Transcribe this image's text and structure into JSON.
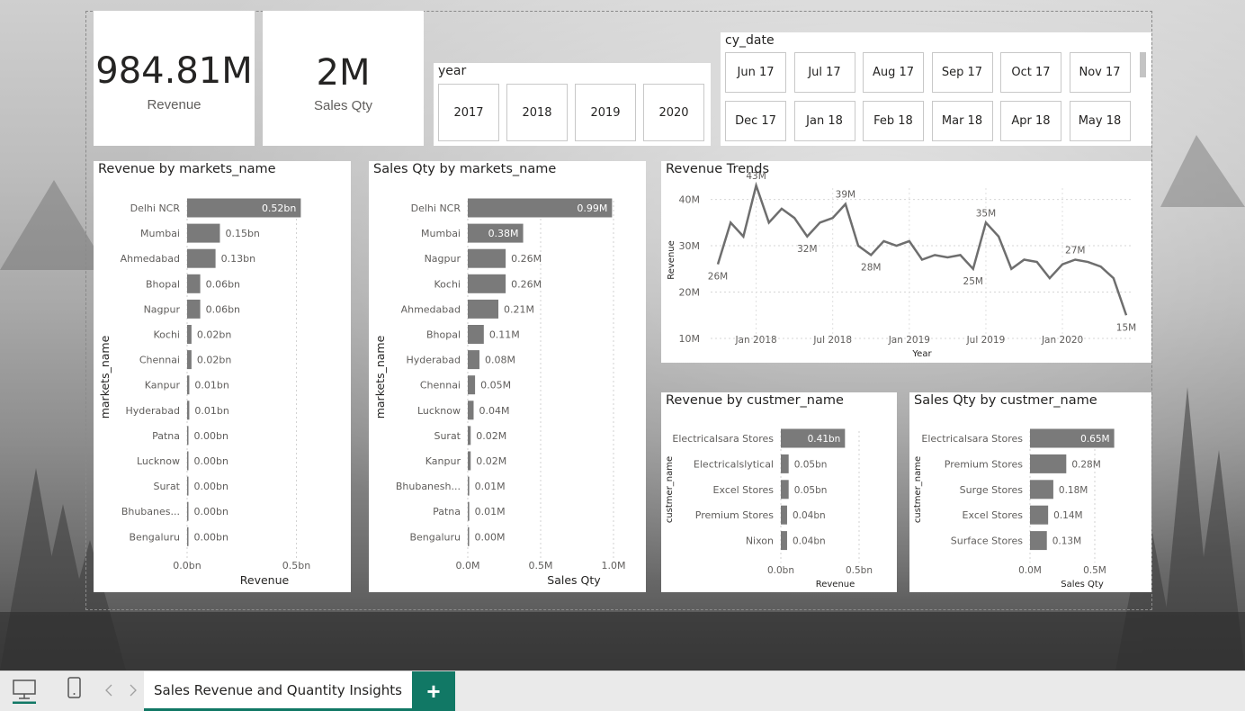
{
  "kpis": {
    "revenue": {
      "value": "984.81M",
      "label": "Revenue"
    },
    "sales_qty": {
      "value": "2M",
      "label": "Sales Qty"
    }
  },
  "year_slicer": {
    "title": "year",
    "options": [
      "2017",
      "2018",
      "2019",
      "2020"
    ]
  },
  "date_slicer": {
    "title": "cy_date",
    "options": [
      "Jun 17",
      "Jul 17",
      "Aug 17",
      "Sep 17",
      "Oct 17",
      "Nov 17",
      "Dec 17",
      "Jan 18",
      "Feb 18",
      "Mar 18",
      "Apr 18",
      "May 18"
    ]
  },
  "tabs": {
    "active": "Sales Revenue and Quantity Insights",
    "add": "+"
  },
  "colors": {
    "bar": "#7a7a7a",
    "accent": "#117865",
    "line": "#6e6e6e"
  },
  "chart_data": [
    {
      "type": "bar",
      "orientation": "horizontal",
      "title": "Revenue by markets_name",
      "xlabel": "Revenue",
      "ylabel": "markets_name",
      "categories": [
        "Delhi NCR",
        "Mumbai",
        "Ahmedabad",
        "Bhopal",
        "Nagpur",
        "Kochi",
        "Chennai",
        "Kanpur",
        "Hyderabad",
        "Patna",
        "Lucknow",
        "Surat",
        "Bhubanes...",
        "Bengaluru"
      ],
      "values": [
        0.52,
        0.15,
        0.13,
        0.06,
        0.06,
        0.02,
        0.02,
        0.01,
        0.01,
        0.0,
        0.0,
        0.0,
        0.0,
        0.0
      ],
      "labels": [
        "0.52bn",
        "0.15bn",
        "0.13bn",
        "0.06bn",
        "0.06bn",
        "0.02bn",
        "0.02bn",
        "0.01bn",
        "0.01bn",
        "0.00bn",
        "0.00bn",
        "0.00bn",
        "0.00bn",
        "0.00bn"
      ],
      "xticks": [
        0,
        0.5
      ],
      "xtick_labels": [
        "0.0bn",
        "0.5bn"
      ],
      "xlim": [
        0,
        0.65
      ]
    },
    {
      "type": "bar",
      "orientation": "horizontal",
      "title": "Sales Qty by markets_name",
      "xlabel": "Sales Qty",
      "ylabel": "markets_name",
      "categories": [
        "Delhi NCR",
        "Mumbai",
        "Nagpur",
        "Kochi",
        "Ahmedabad",
        "Bhopal",
        "Hyderabad",
        "Chennai",
        "Lucknow",
        "Surat",
        "Kanpur",
        "Bhubanesh...",
        "Patna",
        "Bengaluru"
      ],
      "values": [
        0.99,
        0.38,
        0.26,
        0.26,
        0.21,
        0.11,
        0.08,
        0.05,
        0.04,
        0.02,
        0.02,
        0.01,
        0.01,
        0.0
      ],
      "labels": [
        "0.99M",
        "0.38M",
        "0.26M",
        "0.26M",
        "0.21M",
        "0.11M",
        "0.08M",
        "0.05M",
        "0.04M",
        "0.02M",
        "0.02M",
        "0.01M",
        "0.01M",
        "0.00M"
      ],
      "xticks": [
        0,
        0.5,
        1.0
      ],
      "xtick_labels": [
        "0.0M",
        "0.5M",
        "1.0M"
      ],
      "xlim": [
        0,
        1.0
      ]
    },
    {
      "type": "line",
      "title": "Revenue Trends",
      "xlabel": "Year",
      "ylabel": "Revenue",
      "x": [
        "2017-10",
        "2017-11",
        "2017-12",
        "2018-01",
        "2018-02",
        "2018-03",
        "2018-04",
        "2018-05",
        "2018-06",
        "2018-07",
        "2018-08",
        "2018-09",
        "2018-10",
        "2018-11",
        "2018-12",
        "2019-01",
        "2019-02",
        "2019-03",
        "2019-04",
        "2019-05",
        "2019-06",
        "2019-07",
        "2019-08",
        "2019-09",
        "2019-10",
        "2019-11",
        "2019-12",
        "2020-01",
        "2020-02",
        "2020-03",
        "2020-04",
        "2020-05",
        "2020-06"
      ],
      "values": [
        26,
        35,
        32,
        43,
        35,
        38,
        36,
        32,
        35,
        36,
        39,
        30,
        28,
        31,
        30,
        31,
        27,
        28,
        27.5,
        28,
        25,
        35,
        32,
        25,
        27,
        26.5,
        23,
        26,
        27,
        26.5,
        25.5,
        23,
        15
      ],
      "annotations": [
        {
          "index": 0,
          "label": "26M"
        },
        {
          "index": 3,
          "label": "43M"
        },
        {
          "index": 7,
          "label": "32M"
        },
        {
          "index": 10,
          "label": "39M"
        },
        {
          "index": 12,
          "label": "28M"
        },
        {
          "index": 20,
          "label": "25M"
        },
        {
          "index": 21,
          "label": "35M"
        },
        {
          "index": 28,
          "label": "27M"
        },
        {
          "index": 32,
          "label": "15M"
        }
      ],
      "yticks": [
        10,
        20,
        30,
        40
      ],
      "ytick_labels": [
        "10M",
        "20M",
        "30M",
        "40M"
      ],
      "ylim": [
        10,
        44
      ],
      "xtick_labels": [
        "Jan 2018",
        "Jul 2018",
        "Jan 2019",
        "Jul 2019",
        "Jan 2020"
      ],
      "xtick_index": [
        3,
        9,
        15,
        21,
        27
      ]
    },
    {
      "type": "bar",
      "orientation": "horizontal",
      "title": "Revenue by custmer_name",
      "xlabel": "Revenue",
      "ylabel": "custmer_name",
      "categories": [
        "Electricalsara Stores",
        "Electricalslytical",
        "Excel Stores",
        "Premium Stores",
        "Nixon"
      ],
      "values": [
        0.41,
        0.05,
        0.05,
        0.04,
        0.04
      ],
      "labels": [
        "0.41bn",
        "0.05bn",
        "0.05bn",
        "0.04bn",
        "0.04bn"
      ],
      "xticks": [
        0,
        0.5
      ],
      "xtick_labels": [
        "0.0bn",
        "0.5bn"
      ],
      "xlim": [
        0,
        0.5
      ]
    },
    {
      "type": "bar",
      "orientation": "horizontal",
      "title": "Sales Qty by custmer_name",
      "xlabel": "Sales Qty",
      "ylabel": "custmer_name",
      "categories": [
        "Electricalsara Stores",
        "Premium Stores",
        "Surge Stores",
        "Excel Stores",
        "Surface Stores"
      ],
      "values": [
        0.65,
        0.28,
        0.18,
        0.14,
        0.13
      ],
      "labels": [
        "0.65M",
        "0.28M",
        "0.18M",
        "0.14M",
        "0.13M"
      ],
      "xticks": [
        0,
        0.5
      ],
      "xtick_labels": [
        "0.0M",
        "0.5M"
      ],
      "xlim": [
        0,
        0.5
      ]
    }
  ]
}
